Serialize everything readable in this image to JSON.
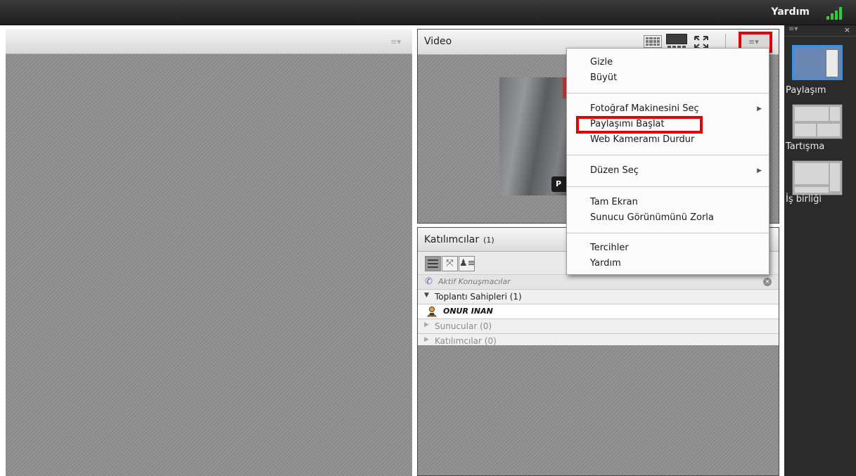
{
  "topbar": {
    "help_label": "Yardım",
    "signal_color": "#33cc33"
  },
  "video_pod": {
    "title": "Video",
    "camera_overlay_text": "P"
  },
  "participants_pod": {
    "title": "Katılımcılar",
    "count": "(1)",
    "active_speakers": "Aktif Konuşmacılar",
    "groups": [
      {
        "label": "Toplantı Sahipleri (1)",
        "expanded": true
      },
      {
        "label": "Sunucular (0)",
        "expanded": false
      },
      {
        "label": "Katılımcılar (0)",
        "expanded": false
      }
    ],
    "hosts": [
      "ONUR INAN"
    ]
  },
  "video_menu": {
    "items": [
      {
        "label": "Gizle"
      },
      {
        "label": "Büyüt"
      },
      {
        "label": "Fotoğraf Makinesini Seç",
        "submenu": true
      },
      {
        "label": "Paylaşımı Başlat",
        "highlighted": true
      },
      {
        "label": "Web Kameramı Durdur"
      },
      {
        "label": "Düzen Seç",
        "submenu": true
      },
      {
        "label": "Tam Ekran"
      },
      {
        "label": "Sunucu Görünümünü Zorla"
      },
      {
        "label": "Tercihler"
      },
      {
        "label": "Yardım"
      }
    ]
  },
  "layouts": [
    {
      "label": "Paylaşım",
      "selected": true
    },
    {
      "label": "Tartışma",
      "selected": false
    },
    {
      "label": "İş birliği",
      "selected": false
    }
  ],
  "colors": {
    "highlight": "#e00000",
    "selected_layout": "#3b8fe0",
    "dark_bar": "#2b2b2b"
  }
}
